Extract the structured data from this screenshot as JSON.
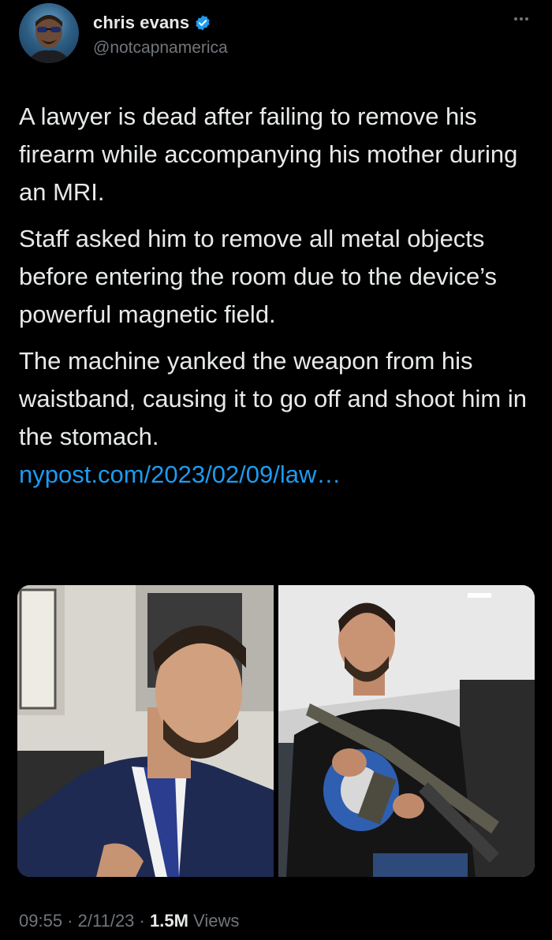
{
  "tweet": {
    "author": {
      "display_name": "chris evans",
      "handle": "@notcapnamerica",
      "verified": true,
      "avatar_icon": "profile-avatar"
    },
    "more_icon": "ellipsis-icon",
    "paragraphs": [
      "A lawyer is dead after failing to remove his firearm while accompanying his mother during an MRI.",
      "Staff asked him to remove all metal objects before entering the room due to the device’s powerful magnetic field.",
      "The machine yanked the weapon from his waistband, causing it to go off and shoot him in the stomach."
    ],
    "link_text": "nypost.com/2023/02/09/law…",
    "media": [
      {
        "kind": "photo",
        "name": "man-in-suit-photo"
      },
      {
        "kind": "photo",
        "name": "man-with-rifle-photo"
      }
    ],
    "time": "09:55",
    "separator": "·",
    "date": "2/11/23",
    "views_count": "1.5M",
    "views_label": "Views"
  },
  "colors": {
    "background": "#000000",
    "text": "#e7e9ea",
    "secondary": "#71767b",
    "link": "#1d9bf0",
    "verified": "#1d9bf0"
  }
}
